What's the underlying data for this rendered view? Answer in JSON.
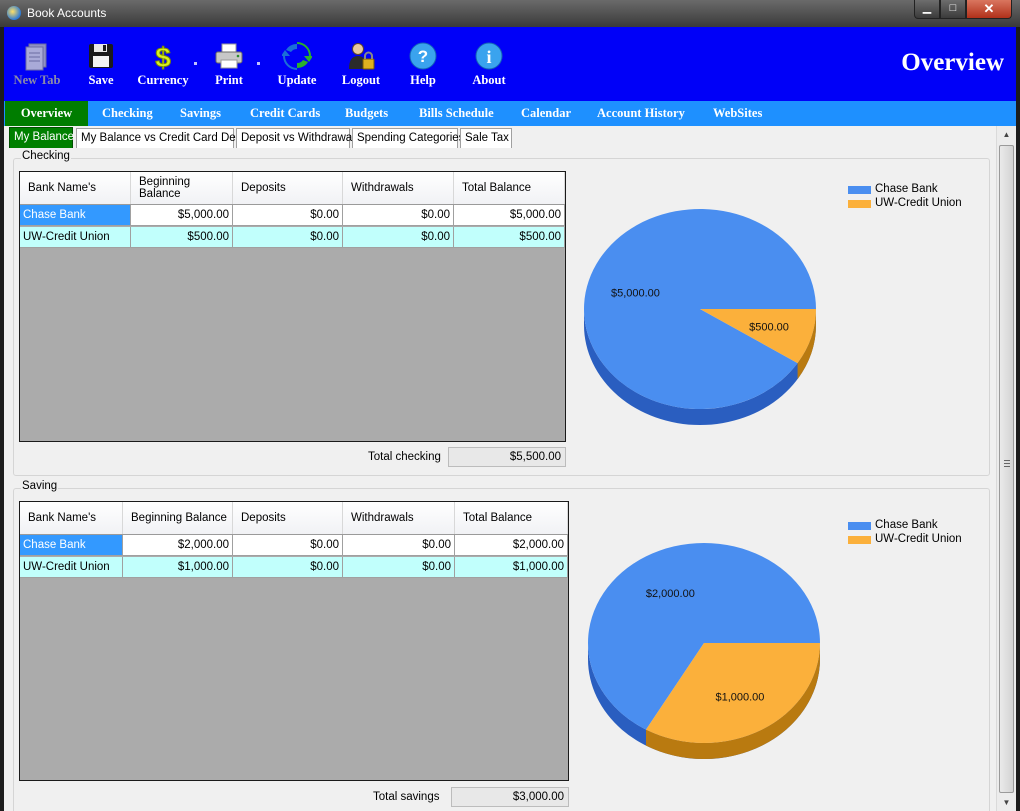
{
  "window": {
    "title": "Book Accounts",
    "minimize": "▁",
    "maximize": "□",
    "close": "✕"
  },
  "toolbar": {
    "items": [
      {
        "label": "New Tab",
        "icon": "new-tab-icon",
        "enabled": false
      },
      {
        "label": "Save",
        "icon": "floppy-disk-icon",
        "enabled": true
      },
      {
        "label": "Currency",
        "icon": "dollar-icon",
        "enabled": true
      },
      {
        "label": "Print",
        "icon": "printer-icon",
        "enabled": true
      },
      {
        "label": "Update",
        "icon": "refresh-icon",
        "enabled": true
      },
      {
        "label": "Logout",
        "icon": "user-lock-icon",
        "enabled": true
      },
      {
        "label": "Help",
        "icon": "help-icon",
        "enabled": true
      },
      {
        "label": "About",
        "icon": "info-icon",
        "enabled": true
      }
    ],
    "heading": "Overview"
  },
  "nav": {
    "items": [
      "Overview",
      "Checking",
      "Savings",
      "Credit Cards",
      "Budgets",
      "Bills Schedule",
      "Calendar",
      "Account History",
      "WebSites"
    ],
    "active": "Overview"
  },
  "subtabs": {
    "items": [
      "My Balance",
      "My Balance vs Credit Card Debt",
      "Deposit vs Withdrawal",
      "Spending Categories",
      "Sale Tax"
    ],
    "active": "My Balance"
  },
  "checking": {
    "group_title": "Checking",
    "columns": [
      "Bank Name's",
      "Beginning Balance",
      "Deposits",
      "Withdrawals",
      "Total Balance"
    ],
    "rows": [
      [
        "Chase Bank",
        "$5,000.00",
        "$0.00",
        "$0.00",
        "$5,000.00"
      ],
      [
        "UW-Credit Union",
        "$500.00",
        "$0.00",
        "$0.00",
        "$500.00"
      ]
    ],
    "total_label": "Total checking",
    "total_value": "$5,500.00"
  },
  "saving": {
    "group_title": "Saving",
    "columns": [
      "Bank Name's",
      "Beginning Balance",
      "Deposits",
      "Withdrawals",
      "Total Balance"
    ],
    "rows": [
      [
        "Chase Bank",
        "$2,000.00",
        "$0.00",
        "$0.00",
        "$2,000.00"
      ],
      [
        "UW-Credit Union",
        "$1,000.00",
        "$0.00",
        "$0.00",
        "$1,000.00"
      ]
    ],
    "total_label": "Total savings",
    "total_value": "$3,000.00"
  },
  "colors": {
    "chase": "#4a8ef0",
    "uwcu": "#fbb03b",
    "nav_active": "#007d00",
    "toolbar": "#0000f8",
    "nav": "#1e90ff"
  },
  "chart_data": [
    {
      "type": "pie",
      "categories": [
        "Chase Bank",
        "UW-Credit Union"
      ],
      "values": [
        5000,
        500
      ],
      "labels": [
        "$5,000.00",
        "$500.00"
      ],
      "legend": "top-right"
    },
    {
      "type": "pie",
      "categories": [
        "Chase Bank",
        "UW-Credit Union"
      ],
      "values": [
        2000,
        1000
      ],
      "labels": [
        "$2,000.00",
        "$1,000.00"
      ],
      "legend": "top-right"
    }
  ]
}
